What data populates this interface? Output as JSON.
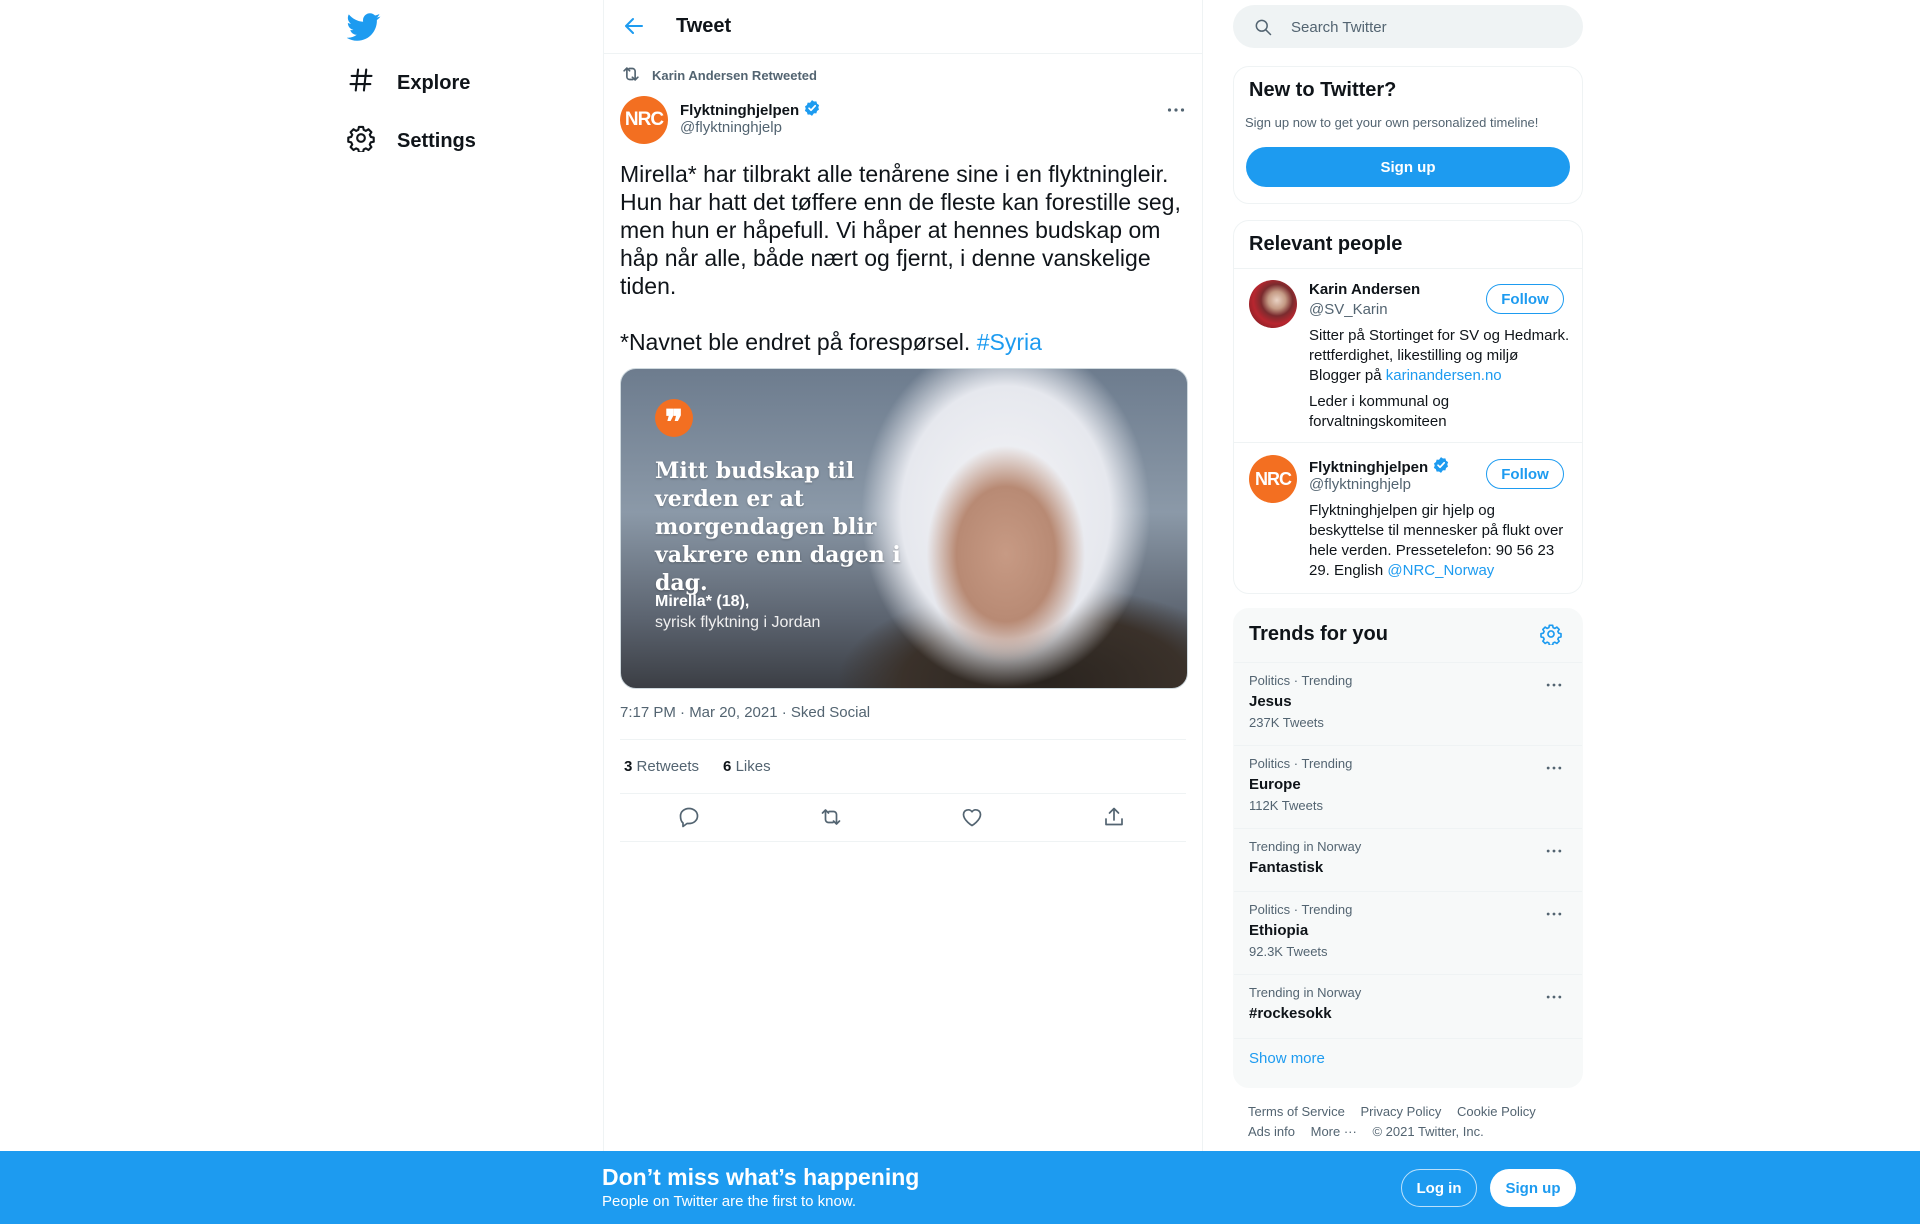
{
  "colors": {
    "brand": "#1d9bf0",
    "nrc_orange": "#f36f21",
    "text": "#0f1419",
    "muted": "#536471"
  },
  "nav": {
    "logo_icon": "twitter-bird-icon",
    "items": [
      {
        "label": "Explore",
        "icon": "hashtag-icon"
      },
      {
        "label": "Settings",
        "icon": "gear-icon"
      }
    ]
  },
  "header": {
    "title": "Tweet",
    "back_icon": "back-arrow-icon"
  },
  "tweet": {
    "retweeted_by": "Karin Andersen Retweeted",
    "author": {
      "name": "Flyktninghjelpen",
      "handle": "@flyktninghjelp",
      "avatar_text": "NRC",
      "verified": true
    },
    "text_p1": "Mirella* har tilbrakt alle tenårene sine i en flyktningleir. Hun har hatt det tøffere enn de fleste kan forestille seg, men hun er håpefull. Vi håper at hennes budskap om håp når alle, både nært og fjernt, i denne vanskelige tiden.",
    "text_p2": "*Navnet ble endret på forespørsel.",
    "hashtag": "#Syria",
    "media": {
      "quote_mark": "❞",
      "quote": "Mitt budskap til verden er at morgendagen blir vakrere enn dagen i dag.",
      "credit_name": "Mirella* (18),",
      "credit_sub": "syrisk flyktning i Jordan"
    },
    "meta": "7:17 PM · Mar 20, 2021 · Sked Social",
    "retweets_count": "3",
    "retweets_label": "Retweets",
    "likes_count": "6",
    "likes_label": "Likes",
    "actions": [
      "reply-icon",
      "retweet-icon",
      "like-icon",
      "share-icon"
    ]
  },
  "search": {
    "placeholder": "Search Twitter"
  },
  "new_to_twitter": {
    "title": "New to Twitter?",
    "subtitle": "Sign up now to get your own personalized timeline!",
    "button": "Sign up"
  },
  "relevant_people": {
    "title": "Relevant people",
    "people": [
      {
        "name": "Karin Andersen",
        "handle": "@SV_Karin",
        "follow": "Follow",
        "bio": "Sitter på Stortinget for SV og Hedmark. rettferdighet, likestilling og miljø Blogger på",
        "bio_link": "karinandersen.no",
        "bio2": "Leder i kommunal og forvaltningskomiteen"
      },
      {
        "name": "Flyktninghjelpen",
        "handle": "@flyktninghjelp",
        "avatar_text": "NRC",
        "follow": "Follow",
        "bio": "Flyktninghjelpen gir hjelp og beskyttelse til mennesker på flukt over hele verden. Pressetelefon: 90 56 23 29. English",
        "bio_link": "@NRC_Norway"
      }
    ]
  },
  "trends": {
    "title": "Trends for you",
    "items": [
      {
        "meta": "Politics · Trending",
        "name": "Jesus",
        "count": "237K Tweets"
      },
      {
        "meta": "Politics · Trending",
        "name": "Europe",
        "count": "112K Tweets"
      },
      {
        "meta": "Trending in Norway",
        "name": "Fantastisk",
        "count": ""
      },
      {
        "meta": "Politics · Trending",
        "name": "Ethiopia",
        "count": "92.3K Tweets"
      },
      {
        "meta": "Trending in Norway",
        "name": "#rockesokk",
        "count": ""
      }
    ],
    "show_more": "Show more"
  },
  "footer": {
    "links": [
      "Terms of Service",
      "Privacy Policy",
      "Cookie Policy",
      "Ads info",
      "More ···"
    ],
    "copyright": "© 2021 Twitter, Inc."
  },
  "bottom_bar": {
    "title": "Don’t miss what’s happening",
    "subtitle": "People on Twitter are the first to know.",
    "login": "Log in",
    "signup": "Sign up"
  }
}
